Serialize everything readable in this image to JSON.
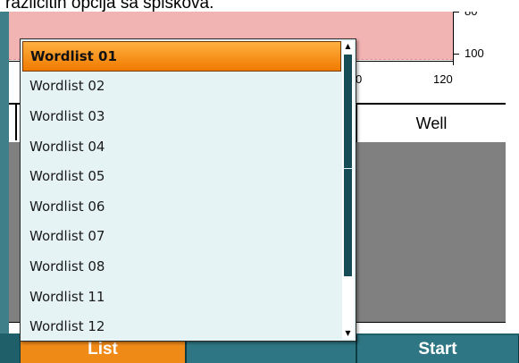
{
  "caption": "različitih opcija sa spiskova.",
  "graph": {
    "y_ticks": [
      "80",
      "100"
    ],
    "x_ticks": [
      "0",
      "120"
    ]
  },
  "table": {
    "header_right": "Well"
  },
  "dropdown": {
    "items": [
      "Wordlist 01",
      "Wordlist 02",
      "Wordlist  03",
      "Wordlist 04",
      "Wordlist  05",
      "Wordlist 06",
      "Wordlist 07",
      "Wordlist 08",
      "Wordlist 11",
      "Wordlist 12"
    ],
    "selected_index": 0
  },
  "buttons": {
    "list": "List",
    "start": "Start"
  },
  "colors": {
    "accent": "#f08a17",
    "bar": "#1f5f6a",
    "graph_fill": "#f2b3b3"
  }
}
